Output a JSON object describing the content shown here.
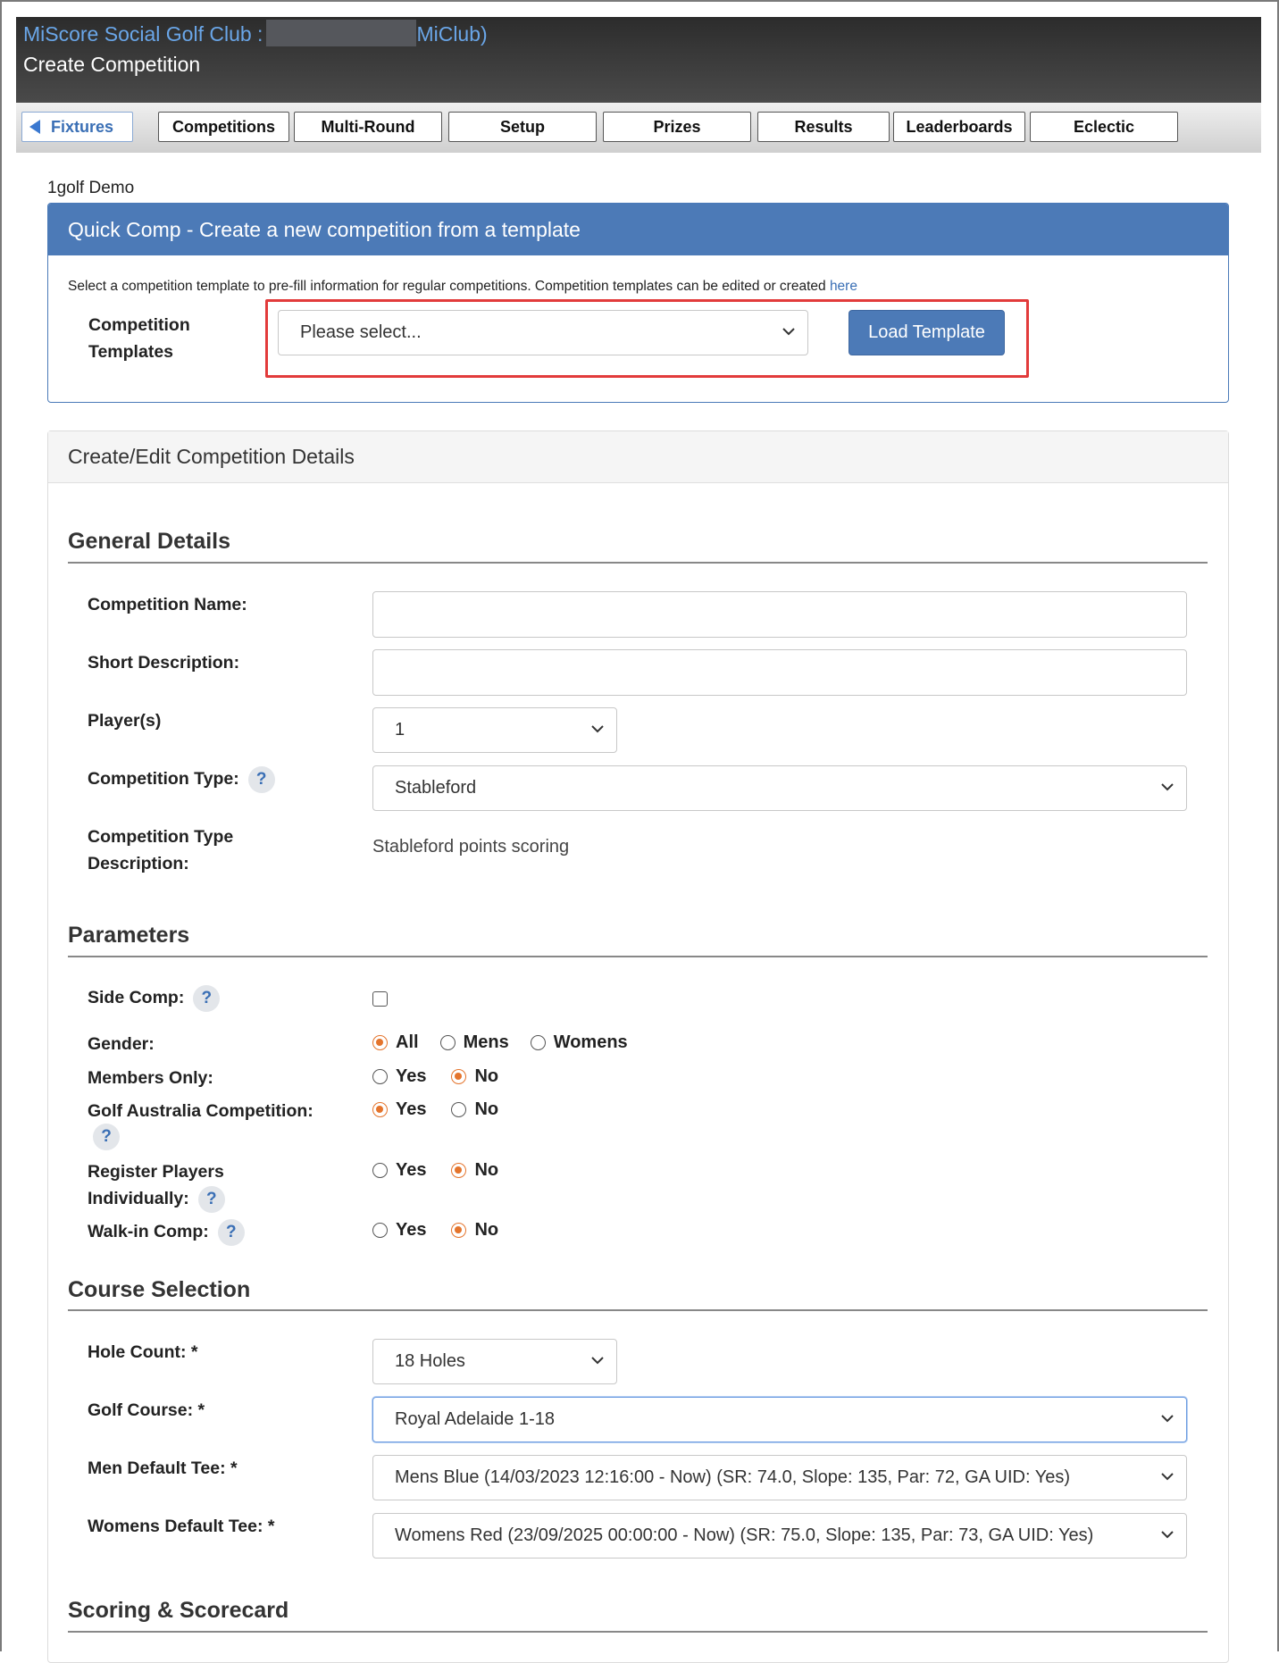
{
  "header": {
    "club_name": "MiScore Social Golf Club :",
    "club_suffix": "MiClub)",
    "page_title": "Create Competition"
  },
  "tabs": [
    {
      "label": "Fixtures",
      "active": true
    },
    {
      "label": "Competitions"
    },
    {
      "label": "Multi-Round"
    },
    {
      "label": "Setup"
    },
    {
      "label": "Prizes"
    },
    {
      "label": "Results"
    },
    {
      "label": "Leaderboards"
    },
    {
      "label": "Eclectic"
    }
  ],
  "org_name": "1golf Demo",
  "quick_comp": {
    "title": "Quick Comp - Create a new competition from a template",
    "description": "Select a competition template to pre-fill information for regular competitions. Competition templates can be edited or created",
    "link": "here",
    "label_line1": "Competition",
    "label_line2": "Templates",
    "select_value": "Please select...",
    "button": "Load Template"
  },
  "details": {
    "title": "Create/Edit Competition Details",
    "general": {
      "heading": "General Details",
      "competition_name_label": "Competition Name:",
      "competition_name_value": "",
      "short_description_label": "Short Description:",
      "short_description_value": "",
      "players_label": "Player(s)",
      "players_value": "1",
      "competition_type_label": "Competition Type:",
      "competition_type_value": "Stableford",
      "type_description_label_line1": "Competition Type",
      "type_description_label_line2": "Description:",
      "type_description_value": "Stableford points scoring"
    },
    "parameters": {
      "heading": "Parameters",
      "side_comp_label": "Side Comp:",
      "side_comp_checked": false,
      "gender_label": "Gender:",
      "gender_options": [
        "All",
        "Mens",
        "Womens"
      ],
      "gender_selected": "All",
      "members_only_label": "Members Only:",
      "golf_australia_label": "Golf Australia Competition:",
      "register_label_line1": "Register Players",
      "register_label_line2": "Individually:",
      "walkin_label": "Walk-in Comp:",
      "yes": "Yes",
      "no": "No",
      "members_only_selected": "No",
      "golf_australia_selected": "Yes",
      "register_selected": "No",
      "walkin_selected": "No"
    },
    "course": {
      "heading": "Course Selection",
      "hole_count_label": "Hole Count: *",
      "hole_count_value": "18 Holes",
      "golf_course_label": "Golf Course: *",
      "golf_course_value": "Royal Adelaide 1-18",
      "men_tee_label": "Men Default Tee: *",
      "men_tee_value": "Mens Blue (14/03/2023 12:16:00 - Now) (SR: 74.0, Slope: 135, Par: 72, GA UID: Yes)",
      "women_tee_label": "Womens Default Tee: *",
      "women_tee_value": "Womens Red (23/09/2025 00:00:00 - Now) (SR: 75.0, Slope: 135, Par: 73, GA UID: Yes)"
    },
    "scoring": {
      "heading": "Scoring & Scorecard"
    }
  },
  "help_glyph": "?",
  "icons": {
    "chevron": "chevron-down-icon",
    "back": "left-triangle-icon",
    "help": "question-icon"
  },
  "colors": {
    "accent": "#4c7ab7",
    "link": "#3a6fb5",
    "radio_selected": "#e4742c",
    "highlight": "#e23b3b",
    "header_bg": "#3a3a3a"
  }
}
